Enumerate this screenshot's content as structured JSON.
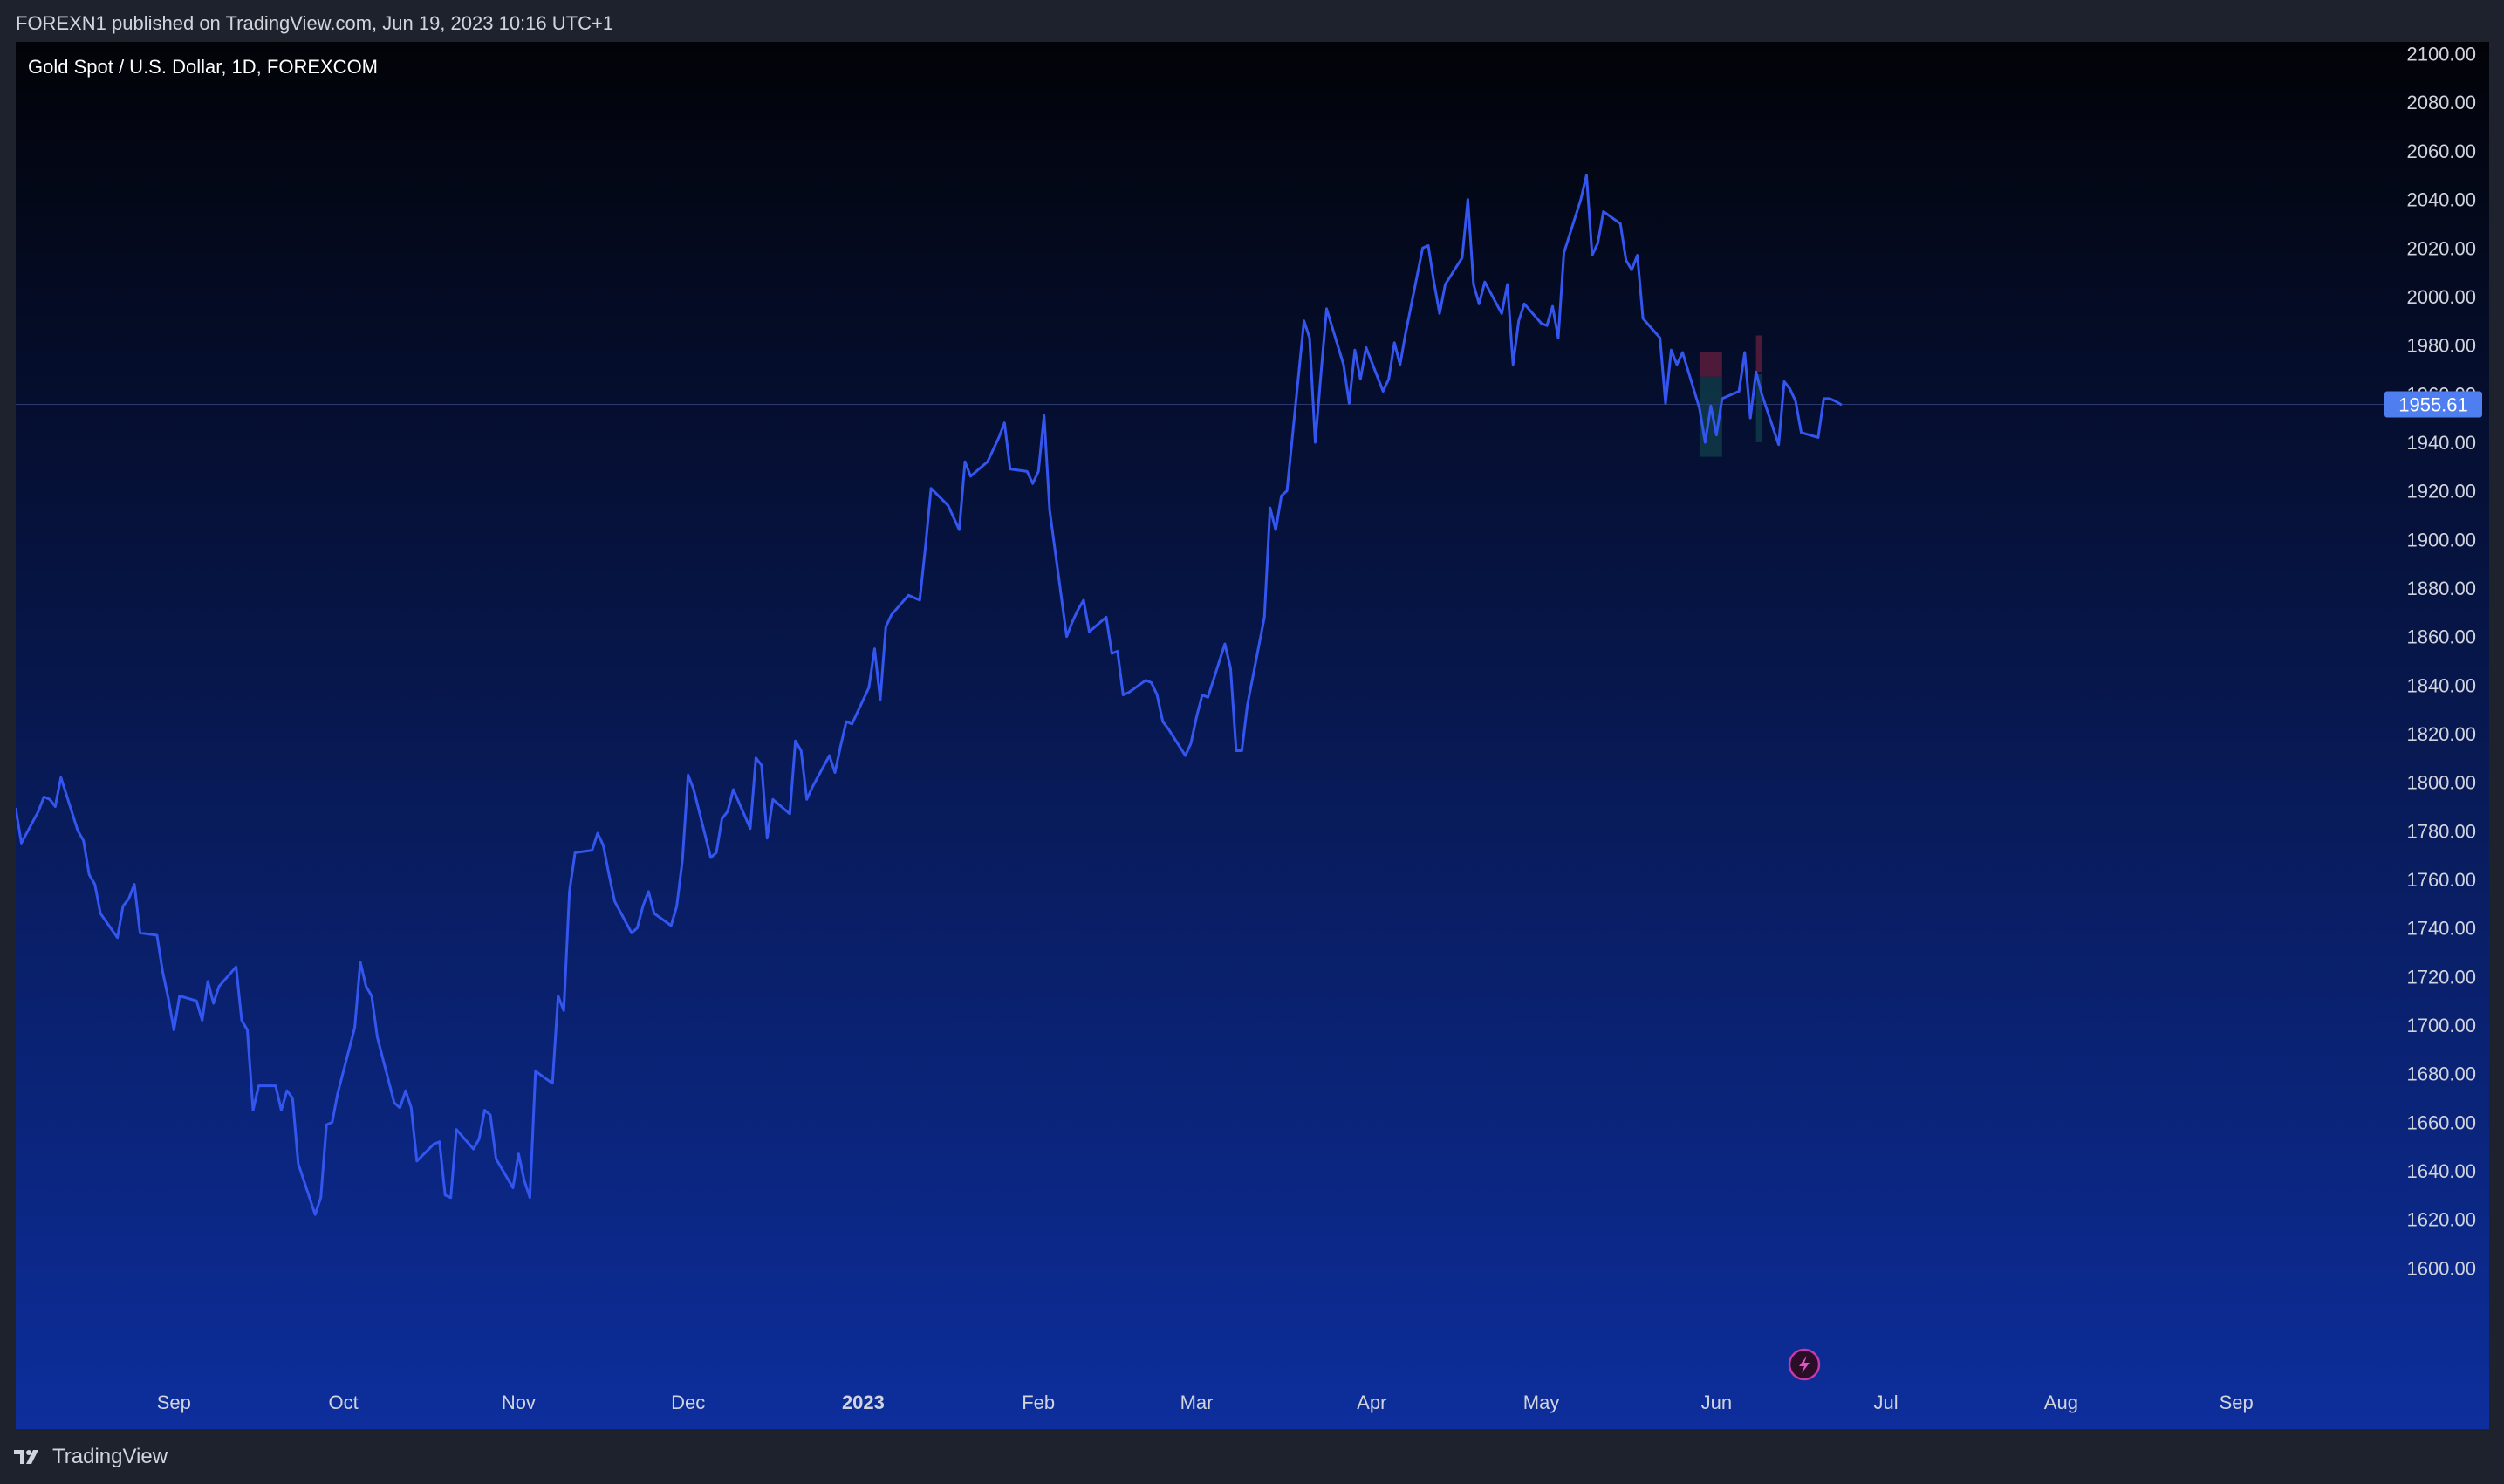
{
  "header": {
    "publish_line": "FOREXN1 published on TradingView.com, Jun 19, 2023 10:16 UTC+1"
  },
  "footer": {
    "brand": "TradingView"
  },
  "colors": {
    "line": "#3456f0",
    "bg_top": "#020308",
    "bg_bottom": "#0d2e9c",
    "price_label_bg": "#4f7ef0",
    "frame": "#1e222d"
  },
  "icons": [
    "tradingview-logo-icon",
    "lightning-bolt-icon"
  ],
  "chart_data": {
    "type": "line",
    "title": "Gold Spot / U.S. Dollar, 1D, FOREXCOM",
    "y_axis_side": "right",
    "ylim": [
      1575,
      2102
    ],
    "xlim": [
      "2022-08-04",
      "2023-09-28"
    ],
    "y_ticks": [
      "2100.00",
      "2080.00",
      "2060.00",
      "2040.00",
      "2020.00",
      "2000.00",
      "1980.00",
      "1960.00",
      "1940.00",
      "1920.00",
      "1900.00",
      "1880.00",
      "1860.00",
      "1840.00",
      "1820.00",
      "1800.00",
      "1780.00",
      "1760.00",
      "1740.00",
      "1720.00",
      "1700.00",
      "1680.00",
      "1660.00",
      "1640.00",
      "1620.00",
      "1600.00"
    ],
    "x_ticks": [
      {
        "label": "Sep",
        "date": "2022-09-01"
      },
      {
        "label": "Oct",
        "date": "2022-10-01"
      },
      {
        "label": "Nov",
        "date": "2022-11-01"
      },
      {
        "label": "Dec",
        "date": "2022-12-01"
      },
      {
        "label": "2023",
        "date": "2023-01-01"
      },
      {
        "label": "Feb",
        "date": "2023-02-01"
      },
      {
        "label": "Mar",
        "date": "2023-03-01"
      },
      {
        "label": "Apr",
        "date": "2023-04-01"
      },
      {
        "label": "May",
        "date": "2023-05-01"
      },
      {
        "label": "Jun",
        "date": "2023-06-01"
      },
      {
        "label": "Jul",
        "date": "2023-07-01"
      },
      {
        "label": "Aug",
        "date": "2023-08-01"
      },
      {
        "label": "Sep",
        "date": "2023-09-01"
      }
    ],
    "last_price": 1955.61,
    "last_price_label": "1955.61",
    "grid": false,
    "series": [
      {
        "values": [
          [
            "2022-08-04",
            1789
          ],
          [
            "2022-08-05",
            1775
          ],
          [
            "2022-08-08",
            1788
          ],
          [
            "2022-08-09",
            1794
          ],
          [
            "2022-08-10",
            1793
          ],
          [
            "2022-08-11",
            1790
          ],
          [
            "2022-08-12",
            1802
          ],
          [
            "2022-08-15",
            1780
          ],
          [
            "2022-08-16",
            1776
          ],
          [
            "2022-08-17",
            1762
          ],
          [
            "2022-08-18",
            1758
          ],
          [
            "2022-08-19",
            1746
          ],
          [
            "2022-08-22",
            1736
          ],
          [
            "2022-08-23",
            1749
          ],
          [
            "2022-08-24",
            1752
          ],
          [
            "2022-08-25",
            1758
          ],
          [
            "2022-08-26",
            1738
          ],
          [
            "2022-08-29",
            1737
          ],
          [
            "2022-08-30",
            1722
          ],
          [
            "2022-08-31",
            1711
          ],
          [
            "2022-09-01",
            1698
          ],
          [
            "2022-09-02",
            1712
          ],
          [
            "2022-09-05",
            1710
          ],
          [
            "2022-09-06",
            1702
          ],
          [
            "2022-09-07",
            1718
          ],
          [
            "2022-09-08",
            1709
          ],
          [
            "2022-09-09",
            1716
          ],
          [
            "2022-09-12",
            1724
          ],
          [
            "2022-09-13",
            1702
          ],
          [
            "2022-09-14",
            1698
          ],
          [
            "2022-09-15",
            1665
          ],
          [
            "2022-09-16",
            1675
          ],
          [
            "2022-09-19",
            1675
          ],
          [
            "2022-09-20",
            1665
          ],
          [
            "2022-09-21",
            1673
          ],
          [
            "2022-09-22",
            1670
          ],
          [
            "2022-09-23",
            1643
          ],
          [
            "2022-09-26",
            1622
          ],
          [
            "2022-09-27",
            1629
          ],
          [
            "2022-09-28",
            1659
          ],
          [
            "2022-09-29",
            1660
          ],
          [
            "2022-09-30",
            1672
          ],
          [
            "2022-10-03",
            1699
          ],
          [
            "2022-10-04",
            1726
          ],
          [
            "2022-10-05",
            1716
          ],
          [
            "2022-10-06",
            1712
          ],
          [
            "2022-10-07",
            1695
          ],
          [
            "2022-10-10",
            1668
          ],
          [
            "2022-10-11",
            1666
          ],
          [
            "2022-10-12",
            1673
          ],
          [
            "2022-10-13",
            1666
          ],
          [
            "2022-10-14",
            1644
          ],
          [
            "2022-10-17",
            1651
          ],
          [
            "2022-10-18",
            1652
          ],
          [
            "2022-10-19",
            1630
          ],
          [
            "2022-10-20",
            1629
          ],
          [
            "2022-10-21",
            1657
          ],
          [
            "2022-10-24",
            1649
          ],
          [
            "2022-10-25",
            1653
          ],
          [
            "2022-10-26",
            1665
          ],
          [
            "2022-10-27",
            1663
          ],
          [
            "2022-10-28",
            1645
          ],
          [
            "2022-10-31",
            1633
          ],
          [
            "2022-11-01",
            1647
          ],
          [
            "2022-11-02",
            1636
          ],
          [
            "2022-11-03",
            1629
          ],
          [
            "2022-11-04",
            1681
          ],
          [
            "2022-11-07",
            1676
          ],
          [
            "2022-11-08",
            1712
          ],
          [
            "2022-11-09",
            1706
          ],
          [
            "2022-11-10",
            1755
          ],
          [
            "2022-11-11",
            1771
          ],
          [
            "2022-11-14",
            1772
          ],
          [
            "2022-11-15",
            1779
          ],
          [
            "2022-11-16",
            1774
          ],
          [
            "2022-11-17",
            1762
          ],
          [
            "2022-11-18",
            1751
          ],
          [
            "2022-11-21",
            1738
          ],
          [
            "2022-11-22",
            1740
          ],
          [
            "2022-11-23",
            1749
          ],
          [
            "2022-11-24",
            1755
          ],
          [
            "2022-11-25",
            1746
          ],
          [
            "2022-11-28",
            1741
          ],
          [
            "2022-11-29",
            1749
          ],
          [
            "2022-11-30",
            1768
          ],
          [
            "2022-12-01",
            1803
          ],
          [
            "2022-12-02",
            1797
          ],
          [
            "2022-12-05",
            1769
          ],
          [
            "2022-12-06",
            1771
          ],
          [
            "2022-12-07",
            1785
          ],
          [
            "2022-12-08",
            1788
          ],
          [
            "2022-12-09",
            1797
          ],
          [
            "2022-12-12",
            1781
          ],
          [
            "2022-12-13",
            1810
          ],
          [
            "2022-12-14",
            1807
          ],
          [
            "2022-12-15",
            1777
          ],
          [
            "2022-12-16",
            1793
          ],
          [
            "2022-12-19",
            1787
          ],
          [
            "2022-12-20",
            1817
          ],
          [
            "2022-12-21",
            1813
          ],
          [
            "2022-12-22",
            1793
          ],
          [
            "2022-12-23",
            1798
          ],
          [
            "2022-12-26",
            1811
          ],
          [
            "2022-12-27",
            1804
          ],
          [
            "2022-12-28",
            1815
          ],
          [
            "2022-12-29",
            1825
          ],
          [
            "2022-12-30",
            1824
          ],
          [
            "2023-01-02",
            1839
          ],
          [
            "2023-01-03",
            1855
          ],
          [
            "2023-01-04",
            1834
          ],
          [
            "2023-01-05",
            1864
          ],
          [
            "2023-01-06",
            1869
          ],
          [
            "2023-01-09",
            1877
          ],
          [
            "2023-01-10",
            1876
          ],
          [
            "2023-01-11",
            1875
          ],
          [
            "2023-01-12",
            1897
          ],
          [
            "2023-01-13",
            1921
          ],
          [
            "2023-01-16",
            1914
          ],
          [
            "2023-01-17",
            1909
          ],
          [
            "2023-01-18",
            1904
          ],
          [
            "2023-01-19",
            1932
          ],
          [
            "2023-01-20",
            1926
          ],
          [
            "2023-01-23",
            1932
          ],
          [
            "2023-01-24",
            1937
          ],
          [
            "2023-01-25",
            1942
          ],
          [
            "2023-01-26",
            1948
          ],
          [
            "2023-01-27",
            1929
          ],
          [
            "2023-01-30",
            1928
          ],
          [
            "2023-01-31",
            1923
          ],
          [
            "2023-02-01",
            1928
          ],
          [
            "2023-02-02",
            1951
          ],
          [
            "2023-02-03",
            1912
          ],
          [
            "2023-02-06",
            1860
          ],
          [
            "2023-02-07",
            1866
          ],
          [
            "2023-02-08",
            1871
          ],
          [
            "2023-02-09",
            1875
          ],
          [
            "2023-02-10",
            1862
          ],
          [
            "2023-02-13",
            1868
          ],
          [
            "2023-02-14",
            1853
          ],
          [
            "2023-02-15",
            1854
          ],
          [
            "2023-02-16",
            1836
          ],
          [
            "2023-02-17",
            1837
          ],
          [
            "2023-02-20",
            1842
          ],
          [
            "2023-02-21",
            1841
          ],
          [
            "2023-02-22",
            1836
          ],
          [
            "2023-02-23",
            1825
          ],
          [
            "2023-02-24",
            1822
          ],
          [
            "2023-02-27",
            1811
          ],
          [
            "2023-02-28",
            1816
          ],
          [
            "2023-03-01",
            1827
          ],
          [
            "2023-03-02",
            1836
          ],
          [
            "2023-03-03",
            1835
          ],
          [
            "2023-03-06",
            1857
          ],
          [
            "2023-03-07",
            1847
          ],
          [
            "2023-03-08",
            1813
          ],
          [
            "2023-03-09",
            1813
          ],
          [
            "2023-03-10",
            1832
          ],
          [
            "2023-03-13",
            1868
          ],
          [
            "2023-03-14",
            1913
          ],
          [
            "2023-03-15",
            1904
          ],
          [
            "2023-03-16",
            1918
          ],
          [
            "2023-03-17",
            1920
          ],
          [
            "2023-03-20",
            1990
          ],
          [
            "2023-03-21",
            1983
          ],
          [
            "2023-03-22",
            1940
          ],
          [
            "2023-03-23",
            1968
          ],
          [
            "2023-03-24",
            1995
          ],
          [
            "2023-03-27",
            1972
          ],
          [
            "2023-03-28",
            1956
          ],
          [
            "2023-03-29",
            1978
          ],
          [
            "2023-03-30",
            1966
          ],
          [
            "2023-03-31",
            1979
          ],
          [
            "2023-04-03",
            1961
          ],
          [
            "2023-04-04",
            1966
          ],
          [
            "2023-04-05",
            1981
          ],
          [
            "2023-04-06",
            1972
          ],
          [
            "2023-04-07",
            1985
          ],
          [
            "2023-04-10",
            2020
          ],
          [
            "2023-04-11",
            2021
          ],
          [
            "2023-04-12",
            2006
          ],
          [
            "2023-04-13",
            1993
          ],
          [
            "2023-04-14",
            2005
          ],
          [
            "2023-04-17",
            2016
          ],
          [
            "2023-04-18",
            2040
          ],
          [
            "2023-04-19",
            2005
          ],
          [
            "2023-04-20",
            1997
          ],
          [
            "2023-04-21",
            2006
          ],
          [
            "2023-04-24",
            1993
          ],
          [
            "2023-04-25",
            2005
          ],
          [
            "2023-04-26",
            1972
          ],
          [
            "2023-04-27",
            1990
          ],
          [
            "2023-04-28",
            1997
          ],
          [
            "2023-05-01",
            1989
          ],
          [
            "2023-05-02",
            1988
          ],
          [
            "2023-05-03",
            1996
          ],
          [
            "2023-05-04",
            1983
          ],
          [
            "2023-05-05",
            2018
          ],
          [
            "2023-05-08",
            2040
          ],
          [
            "2023-05-09",
            2050
          ],
          [
            "2023-05-10",
            2017
          ],
          [
            "2023-05-11",
            2022
          ],
          [
            "2023-05-12",
            2035
          ],
          [
            "2023-05-15",
            2030
          ],
          [
            "2023-05-16",
            2015
          ],
          [
            "2023-05-17",
            2011
          ],
          [
            "2023-05-18",
            2017
          ],
          [
            "2023-05-19",
            1991
          ],
          [
            "2023-05-22",
            1983
          ],
          [
            "2023-05-23",
            1956
          ],
          [
            "2023-05-24",
            1978
          ],
          [
            "2023-05-25",
            1972
          ],
          [
            "2023-05-26",
            1977
          ],
          [
            "2023-05-29",
            1954
          ],
          [
            "2023-05-30",
            1940
          ],
          [
            "2023-05-31",
            1955
          ],
          [
            "2023-06-01",
            1943
          ],
          [
            "2023-06-02",
            1958
          ],
          [
            "2023-06-05",
            1961
          ],
          [
            "2023-06-06",
            1977
          ],
          [
            "2023-06-07",
            1950
          ],
          [
            "2023-06-08",
            1969
          ],
          [
            "2023-06-09",
            1960
          ],
          [
            "2023-06-12",
            1939
          ],
          [
            "2023-06-13",
            1965
          ],
          [
            "2023-06-14",
            1962
          ],
          [
            "2023-06-15",
            1957
          ],
          [
            "2023-06-16",
            1944
          ],
          [
            "2023-06-19",
            1942
          ],
          [
            "2023-06-20",
            1958
          ],
          [
            "2023-06-21",
            1958
          ],
          [
            "2023-06-22",
            1957
          ],
          [
            "2023-06-23",
            1955.61
          ]
        ]
      }
    ],
    "shaded_boxes": [
      {
        "kind": "loss",
        "x0": "2023-05-29",
        "x1": "2023-06-02",
        "y0": 1967,
        "y1": 1977,
        "color": "#5a1f3c"
      },
      {
        "kind": "gain",
        "x0": "2023-05-29",
        "x1": "2023-06-02",
        "y0": 1934,
        "y1": 1967,
        "color": "#0f3a48"
      },
      {
        "kind": "loss",
        "x0": "2023-06-08",
        "x1": "2023-06-09",
        "y0": 1969,
        "y1": 1984,
        "color": "#5a1f3c"
      },
      {
        "kind": "gain",
        "x0": "2023-06-08",
        "x1": "2023-06-09",
        "y0": 1940,
        "y1": 1968,
        "color": "#0f3a48"
      }
    ]
  }
}
